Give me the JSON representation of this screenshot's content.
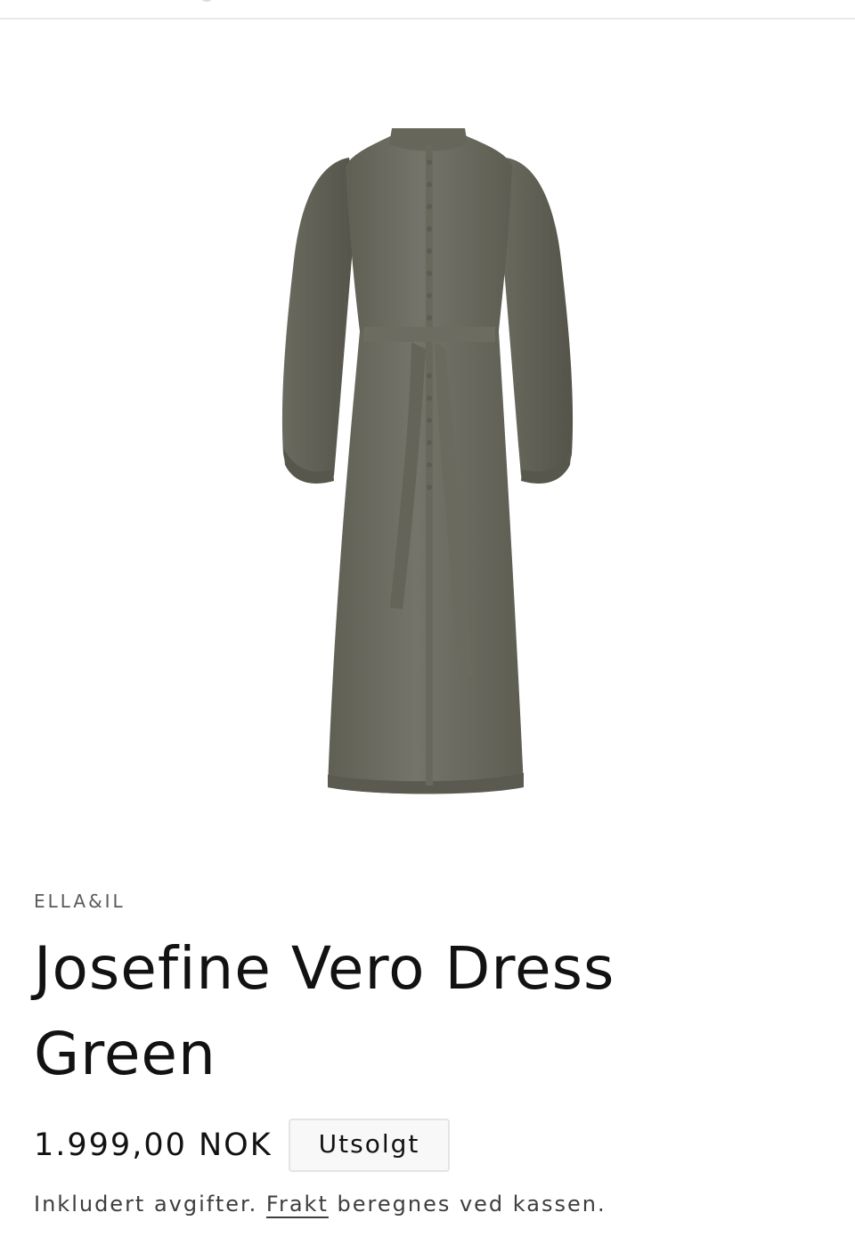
{
  "product": {
    "vendor": "ELLA&IL",
    "title": "Josefine Vero Dress Green",
    "price": "1.999,00 NOK",
    "availability_badge": "Utsolgt",
    "tax_note_prefix": "Inkludert avgifter.",
    "shipping_link": "Frakt",
    "tax_note_suffix": "beregnes ved kassen.",
    "image_color": "#6f6f63"
  }
}
